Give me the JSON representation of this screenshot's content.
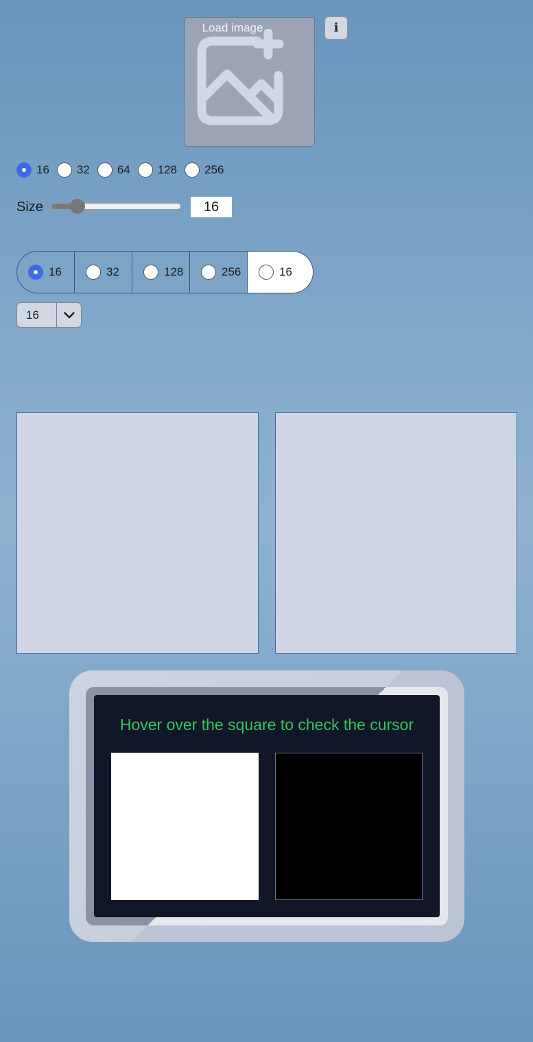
{
  "toolbar": {
    "load_image_label": "Load image",
    "load_image_icon": "add-image-icon",
    "info_label": "i"
  },
  "size_radios": {
    "selected": "16",
    "options": [
      "16",
      "32",
      "64",
      "128",
      "256"
    ]
  },
  "size_slider": {
    "label": "Size",
    "value": "16",
    "fraction": 0.2
  },
  "segmented": {
    "selected": "16",
    "options": [
      "16",
      "32",
      "128",
      "256",
      "16"
    ]
  },
  "size_select": {
    "value": "16"
  },
  "cursor_test": {
    "message": "Hover over the square to check the cursor"
  },
  "colors": {
    "accent": "#3f6ae0",
    "message_text": "#34c759",
    "screen_bg": "#111629",
    "panel_bg": "#cfd5e2"
  }
}
